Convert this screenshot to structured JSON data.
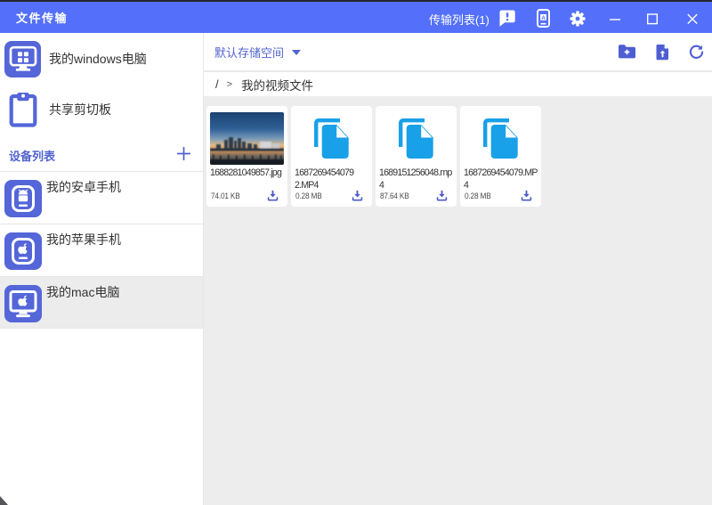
{
  "window": {
    "title": "文件传输"
  },
  "titlebar": {
    "transfer_list_label": "传输列表(1)",
    "icons": [
      "feedback-bubble",
      "phone-mirror",
      "settings-gear",
      "minimize",
      "maximize",
      "close"
    ]
  },
  "sidebar": {
    "my_computer": {
      "label": "我的windows电脑",
      "icon": "windows-monitor"
    },
    "clipboard": {
      "label": "共享剪切板",
      "icon": "clipboard"
    },
    "device_list": {
      "label": "设备列表",
      "add_icon": "plus"
    },
    "devices": [
      {
        "label": "我的安卓手机",
        "icon": "android-phone",
        "selected": false
      },
      {
        "label": "我的苹果手机",
        "icon": "apple-phone",
        "selected": false
      },
      {
        "label": "我的mac电脑",
        "icon": "mac-monitor",
        "selected": true
      }
    ]
  },
  "toolbar": {
    "storage_selector": "默认存储空间",
    "actions": [
      "new-folder",
      "upload-file",
      "refresh"
    ]
  },
  "breadcrumb": {
    "root": "/",
    "separator": ">",
    "current": "我的视频文件"
  },
  "files": [
    {
      "name": "1688281049857.jpg",
      "size": "74.01 KB",
      "thumbnail": "photo-sunset"
    },
    {
      "name": "1687269454079 2.MP4",
      "size": "0.28 MB",
      "thumbnail": "file-copy-icon"
    },
    {
      "name": "1689151256048.mp4",
      "size": "87.64 KB",
      "thumbnail": "file-copy-icon"
    },
    {
      "name": "1687269454079.MP4",
      "size": "0.28 MB",
      "thumbnail": "file-copy-icon"
    }
  ],
  "colors": {
    "titlebar": "#5470fa",
    "accent_blue": "#5163cf",
    "tile_blue": "#5466d8",
    "file_icon_blue": "#18a0e8",
    "download_icon": "#4a5bc8",
    "content_bg": "#eeedee",
    "selected_row": "#ececec"
  }
}
